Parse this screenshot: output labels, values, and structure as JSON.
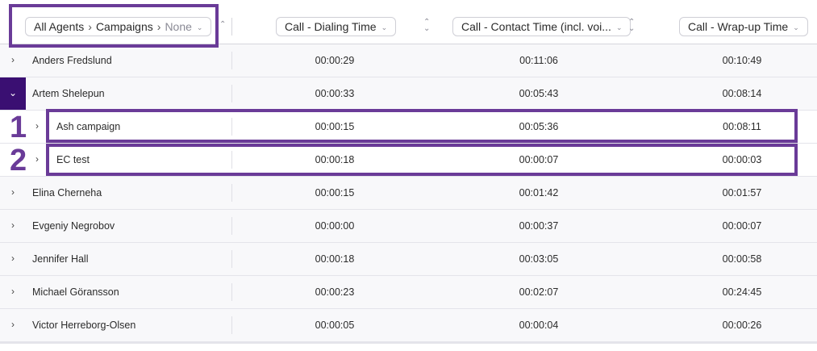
{
  "header": {
    "breadcrumb": {
      "level1": "All Agents",
      "level2": "Campaigns",
      "level3": "None"
    },
    "columns": [
      {
        "label": "Call - Dialing Time"
      },
      {
        "label": "Call - Contact Time (incl. voi..."
      },
      {
        "label": "Call - Wrap-up Time"
      }
    ]
  },
  "rows": [
    {
      "name": "Anders Fredslund",
      "dialing": "00:00:29",
      "contact": "00:11:06",
      "wrapup": "00:10:49"
    },
    {
      "name": "Artem Shelepun",
      "dialing": "00:00:33",
      "contact": "00:05:43",
      "wrapup": "00:08:14"
    },
    {
      "name": "Ash campaign",
      "dialing": "00:00:15",
      "contact": "00:05:36",
      "wrapup": "00:08:11"
    },
    {
      "name": "EC test",
      "dialing": "00:00:18",
      "contact": "00:00:07",
      "wrapup": "00:00:03"
    },
    {
      "name": "Elina Cherneha",
      "dialing": "00:00:15",
      "contact": "00:01:42",
      "wrapup": "00:01:57"
    },
    {
      "name": "Evgeniy Negrobov",
      "dialing": "00:00:00",
      "contact": "00:00:37",
      "wrapup": "00:00:07"
    },
    {
      "name": "Jennifer Hall",
      "dialing": "00:00:18",
      "contact": "00:03:05",
      "wrapup": "00:00:58"
    },
    {
      "name": "Michael Göransson",
      "dialing": "00:00:23",
      "contact": "00:02:07",
      "wrapup": "00:24:45"
    },
    {
      "name": "Victor Herreborg-Olsen",
      "dialing": "00:00:05",
      "contact": "00:00:04",
      "wrapup": "00:00:26"
    }
  ],
  "annotations": {
    "marker1": "1",
    "marker2": "2"
  },
  "icons": {
    "expand": "chevron-right-icon",
    "collapse": "chevron-down-icon",
    "sort": "sort-icon"
  },
  "colors": {
    "accent": "#3a0f72",
    "highlight": "#6a3b98"
  }
}
